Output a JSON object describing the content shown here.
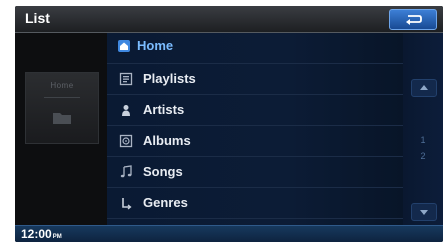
{
  "header": {
    "title": "List"
  },
  "sidebar": {
    "label": "Home"
  },
  "list": {
    "items": [
      {
        "label": "Home",
        "icon": "home-icon"
      },
      {
        "label": "Playlists",
        "icon": "playlist-icon"
      },
      {
        "label": "Artists",
        "icon": "artist-icon"
      },
      {
        "label": "Albums",
        "icon": "album-icon"
      },
      {
        "label": "Songs",
        "icon": "music-note-icon"
      },
      {
        "label": "Genres",
        "icon": "genre-icon"
      }
    ]
  },
  "scroll": {
    "pages": [
      "1",
      "2"
    ]
  },
  "status": {
    "time": "12:00",
    "ampm": "PM"
  },
  "colors": {
    "accent": "#7bbcff",
    "list_bg": "#0c1c36",
    "button": "#2a66b8"
  }
}
